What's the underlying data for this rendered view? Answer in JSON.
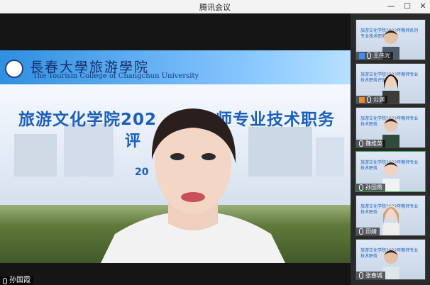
{
  "window": {
    "title": "腾讯会议",
    "minimize_label": "—",
    "maximize_label": "☐",
    "close_label": "✕"
  },
  "slide": {
    "logo_cn": "長春大學旅游學院",
    "logo_en": "The Tourism College of Changchun University",
    "title_left": "旅游文化学院202",
    "title_right": "师专业技术职务",
    "subtitle": "评",
    "year_text": "20"
  },
  "main_speaker": {
    "name": "孙国霞"
  },
  "participants": [
    {
      "name": "王伟光",
      "thumb_text": "旅游文化学院2022年教师系列专业技术职务",
      "badge": "user"
    },
    {
      "name": "公渊",
      "thumb_text": "旅游文化学院2022年教师专业技术职务评审会",
      "badge": "host"
    },
    {
      "name": "魏维英",
      "thumb_text": "旅游文化学院2022年教师专业技术职务",
      "badge": "none"
    },
    {
      "name": "孙国霞",
      "thumb_text": "旅游文化学院2022年教师专业技术职务",
      "badge": "none",
      "active": true
    },
    {
      "name": "田婧",
      "thumb_text": "旅游文化学院2022年教师专业技术职务",
      "badge": "none"
    },
    {
      "name": "张春城",
      "thumb_text": "旅游文化学院2022年教师专业技术职务",
      "badge": "none"
    }
  ]
}
